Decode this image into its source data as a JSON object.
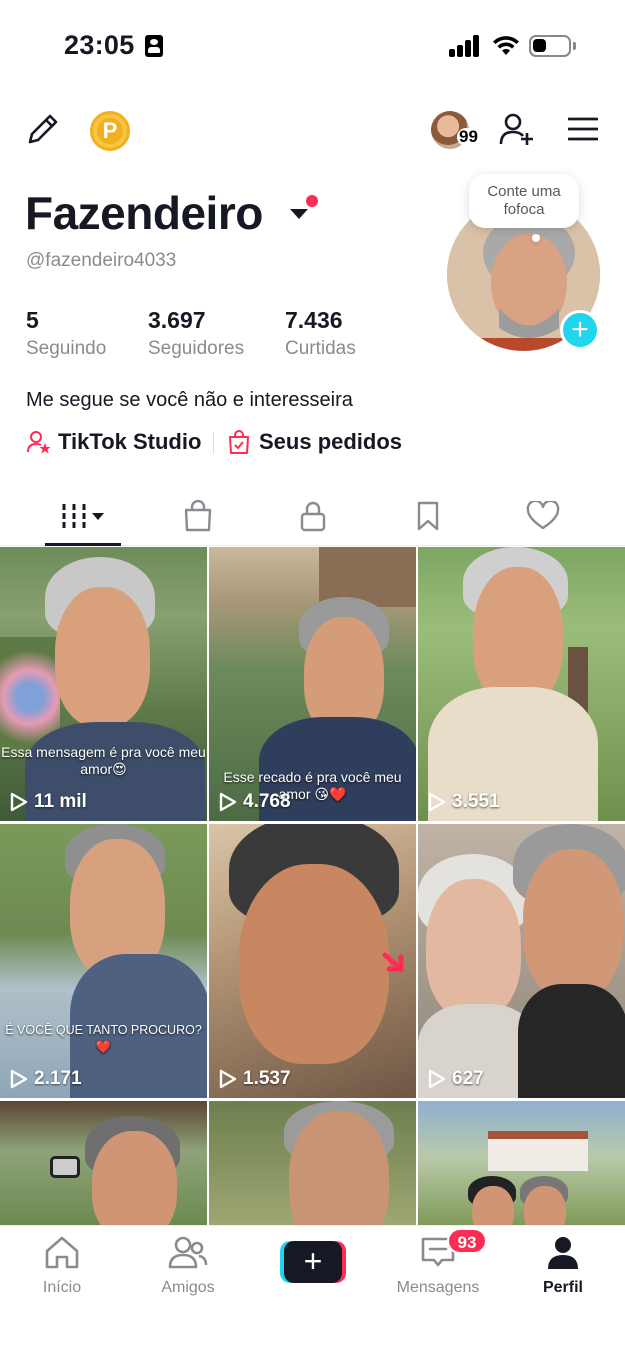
{
  "status_bar": {
    "time": "23:05"
  },
  "profile": {
    "name": "Fazendeiro",
    "handle": "@fazendeiro4033",
    "bubble_text": "Conte uma fofoca",
    "mini_avatar_count": "99",
    "stats": [
      {
        "value": "5",
        "label": "Seguindo"
      },
      {
        "value": "3.697",
        "label": "Seguidores"
      },
      {
        "value": "7.436",
        "label": "Curtidas"
      }
    ],
    "bio": "Me segue se você não e interesseira",
    "links": {
      "studio": "TikTok Studio",
      "orders": "Seus pedidos"
    }
  },
  "tabs": [
    "videos-grid",
    "shop",
    "private",
    "saved",
    "liked"
  ],
  "videos": [
    {
      "caption": "Essa mensagem é pra você meu amor😍",
      "views": "11 mil"
    },
    {
      "caption": "Esse recado é pra você meu amor 😘❤️",
      "views": "4.768"
    },
    {
      "caption": "",
      "views": "3.551"
    },
    {
      "caption": "É VOCÊ QUE TANTO PROCURO? ❤️",
      "views": "2.171"
    },
    {
      "caption": "",
      "views": "1.537"
    },
    {
      "caption": "",
      "views": "627"
    },
    {
      "caption": "",
      "views": ""
    },
    {
      "caption": "",
      "views": ""
    },
    {
      "caption": "",
      "views": ""
    }
  ],
  "nav": {
    "home": "Início",
    "friends": "Amigos",
    "messages": "Mensagens",
    "messages_badge": "93",
    "profile": "Perfil"
  },
  "colors": {
    "accent_red": "#fe2c55",
    "accent_cyan": "#20d5ec",
    "text": "#161823",
    "muted": "#8a8b91"
  }
}
